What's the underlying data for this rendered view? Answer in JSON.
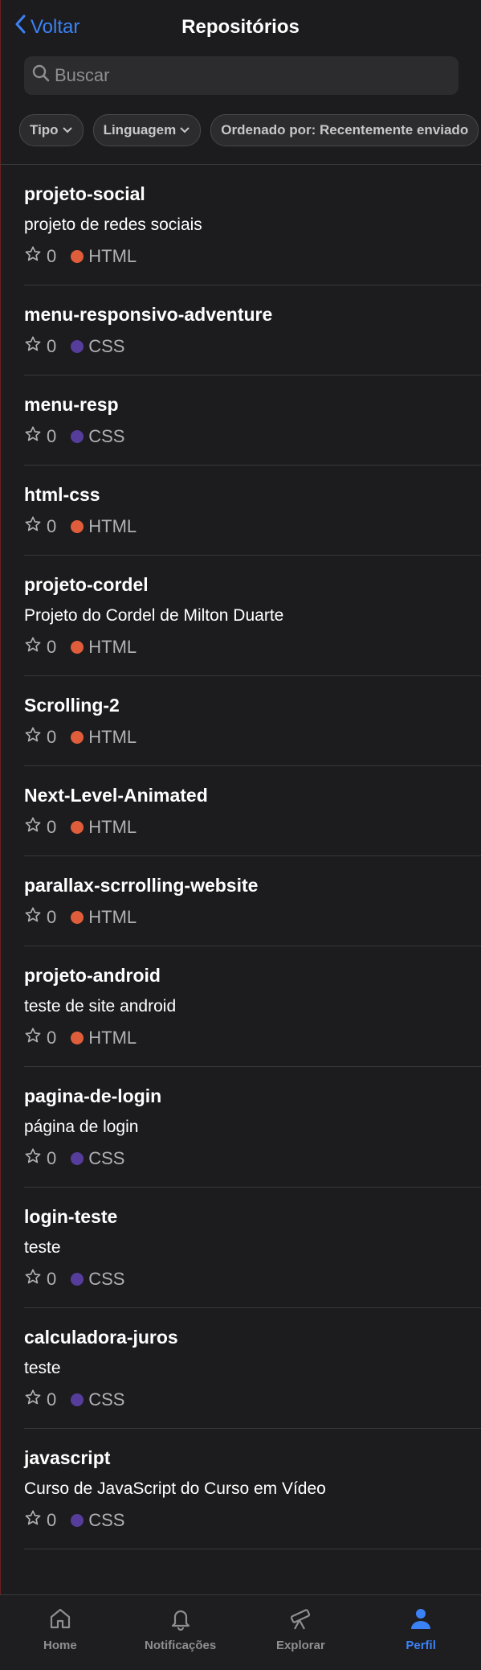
{
  "header": {
    "back_label": "Voltar",
    "title": "Repositórios"
  },
  "search": {
    "placeholder": "Buscar"
  },
  "filters": [
    {
      "label": "Tipo"
    },
    {
      "label": "Linguagem"
    },
    {
      "label": "Ordenado por: Recentemente enviado"
    }
  ],
  "colors": {
    "HTML": "#e05d3b",
    "CSS": "#563d9c",
    "accent": "#3b82f6"
  },
  "repos": [
    {
      "name": "projeto-social",
      "description": "projeto de redes sociais",
      "stars": "0",
      "language": "HTML"
    },
    {
      "name": "menu-responsivo-adventure",
      "description": "",
      "stars": "0",
      "language": "CSS"
    },
    {
      "name": "menu-resp",
      "description": "",
      "stars": "0",
      "language": "CSS"
    },
    {
      "name": "html-css",
      "description": "",
      "stars": "0",
      "language": "HTML"
    },
    {
      "name": "projeto-cordel",
      "description": "Projeto do Cordel de Milton Duarte",
      "stars": "0",
      "language": "HTML"
    },
    {
      "name": "Scrolling-2",
      "description": "",
      "stars": "0",
      "language": "HTML"
    },
    {
      "name": "Next-Level-Animated",
      "description": "",
      "stars": "0",
      "language": "HTML"
    },
    {
      "name": "parallax-scrrolling-website",
      "description": "",
      "stars": "0",
      "language": "HTML"
    },
    {
      "name": "projeto-android",
      "description": "teste de site android",
      "stars": "0",
      "language": "HTML"
    },
    {
      "name": "pagina-de-login",
      "description": "página de login",
      "stars": "0",
      "language": "CSS"
    },
    {
      "name": "login-teste",
      "description": "teste",
      "stars": "0",
      "language": "CSS"
    },
    {
      "name": "calculadora-juros",
      "description": "teste",
      "stars": "0",
      "language": "CSS"
    },
    {
      "name": "javascript",
      "description": "Curso de JavaScript do Curso em Vídeo",
      "stars": "0",
      "language": "CSS"
    }
  ],
  "tabbar": [
    {
      "label": "Home",
      "icon": "home-icon",
      "active": false
    },
    {
      "label": "Notificações",
      "icon": "bell-icon",
      "active": false
    },
    {
      "label": "Explorar",
      "icon": "telescope-icon",
      "active": false
    },
    {
      "label": "Perfil",
      "icon": "person-icon",
      "active": true
    }
  ]
}
